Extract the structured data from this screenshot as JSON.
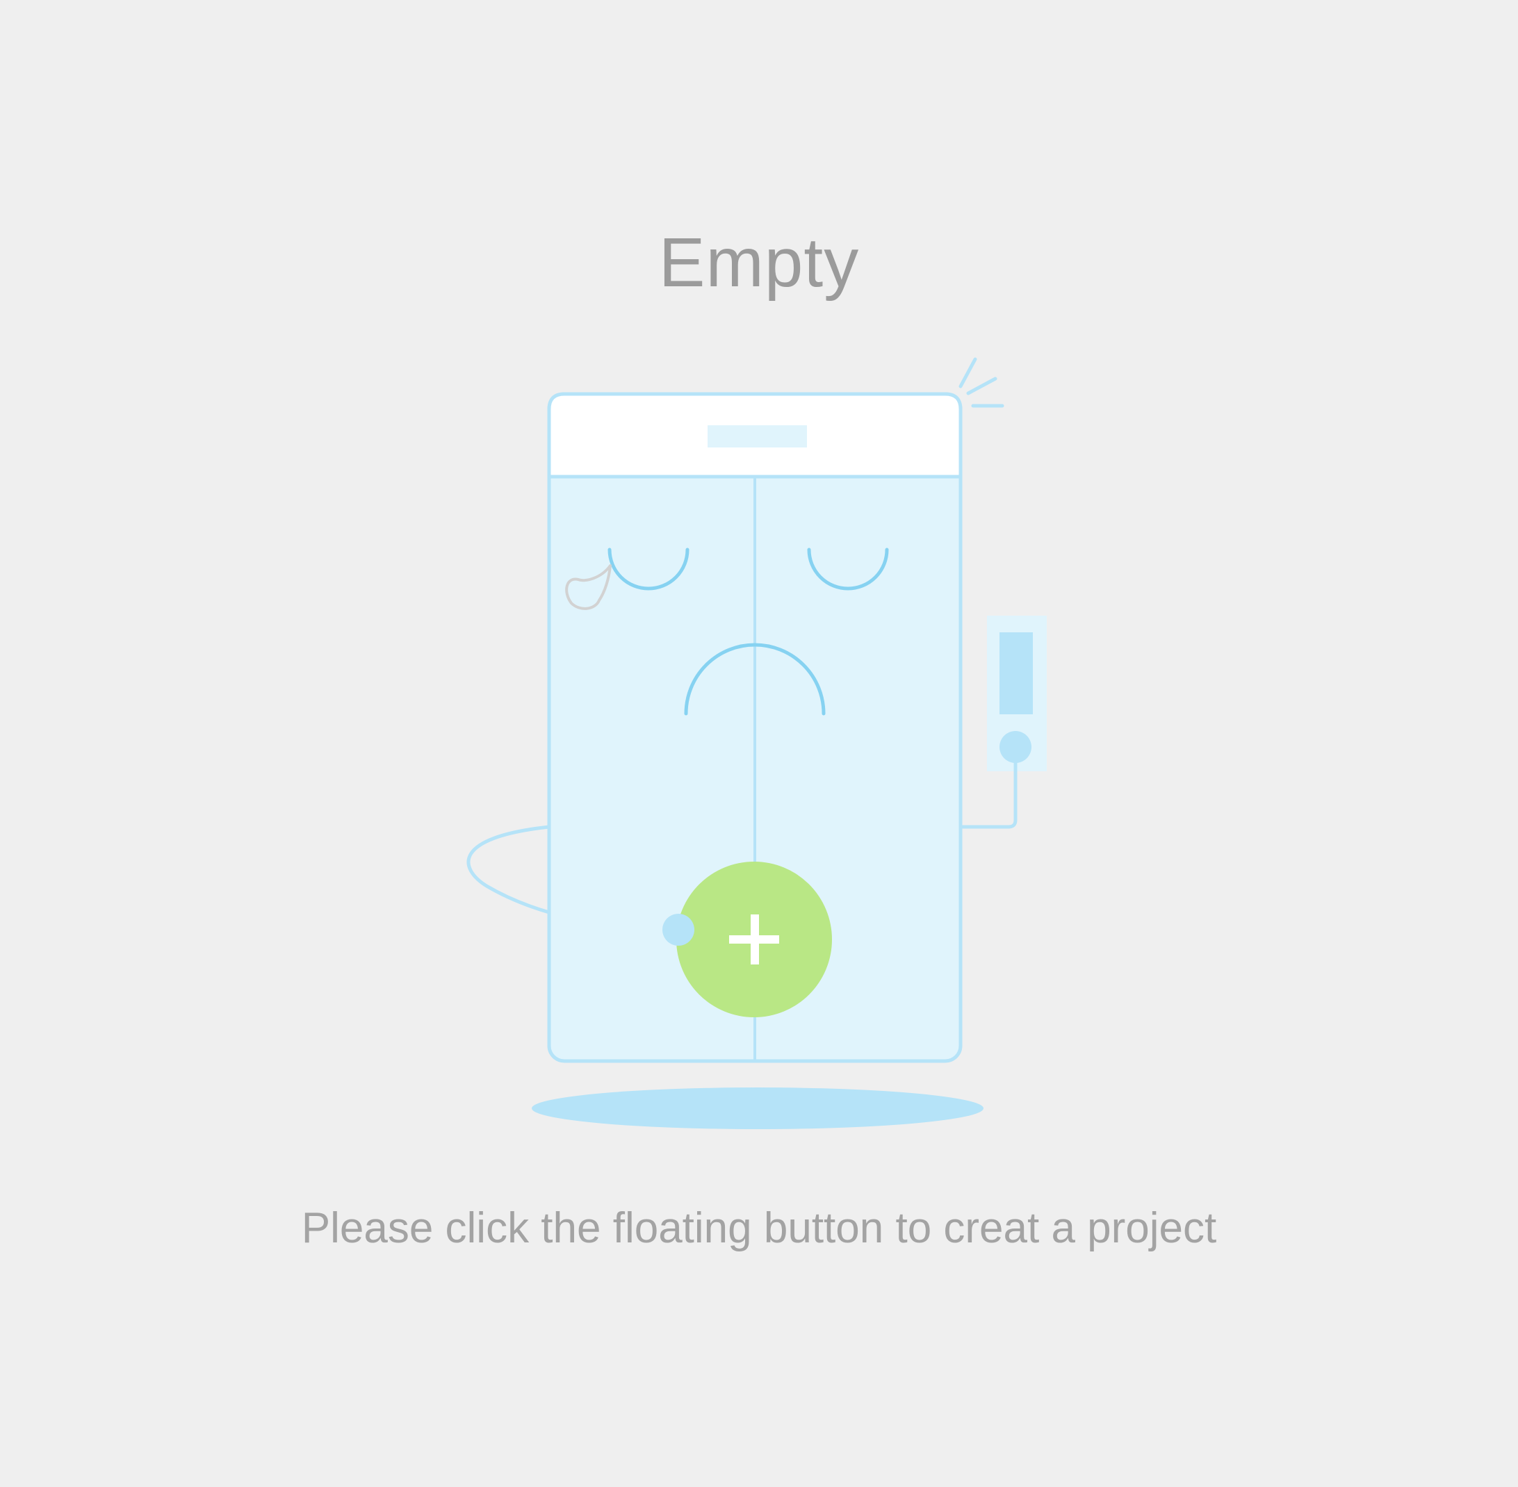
{
  "empty_state": {
    "title": "Empty",
    "message": "Please click the floating button to creat a project",
    "illustration": {
      "subject": "sad phone with a floating add button",
      "fab_icon": "plus-icon",
      "colors": {
        "background": "#efefef",
        "screen": "#e0f4fc",
        "outline": "#b5e3f8",
        "face_lines": "#86d2f1",
        "fab": "#b9e785",
        "tear": "#d2d2d2",
        "text": "#9b9b9b"
      }
    }
  }
}
